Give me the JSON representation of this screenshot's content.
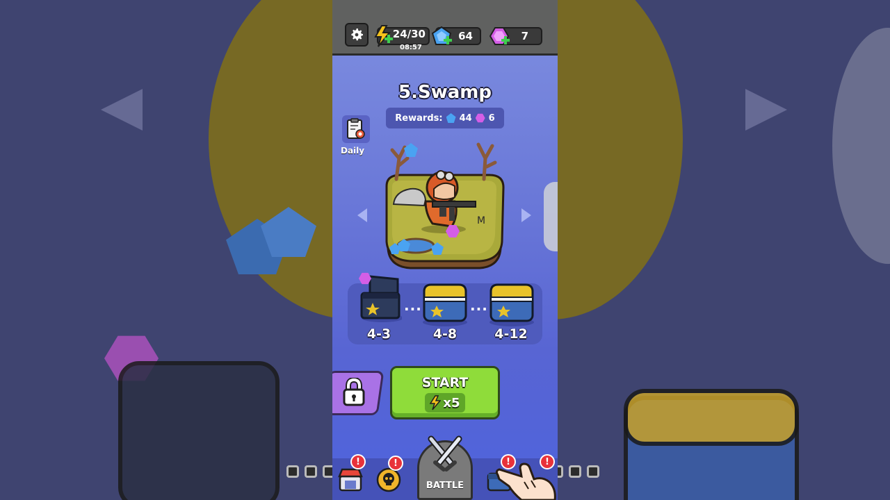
{
  "header": {
    "energy": "24/30",
    "energy_timer": "08:57",
    "blue_gems": "64",
    "purple_gems": "7"
  },
  "level": {
    "title": "5.Swamp",
    "rewards_label": "Rewards:",
    "reward_blue": "44",
    "reward_purple": "6"
  },
  "daily": {
    "label": "Daily"
  },
  "milestones": [
    {
      "label": "4-3",
      "state": "opened"
    },
    {
      "label": "4-8",
      "state": "locked"
    },
    {
      "label": "4-12",
      "state": "locked"
    }
  ],
  "milestone_separator": "...",
  "start": {
    "label": "START",
    "cost": "x5"
  },
  "bottom_nav": {
    "battle_label": "BATTLE",
    "badge_text": "!"
  },
  "colors": {
    "accent_green": "#8fdc3a",
    "accent_purple": "#a972e6",
    "gem_blue": "#4aa3f2",
    "gem_purple": "#d45ee6",
    "energy_yellow": "#f5c21b"
  },
  "icons": [
    "gear-icon",
    "lightning-icon",
    "blue-gem-icon",
    "purple-gem-icon",
    "daily-quest-icon",
    "lock-icon",
    "crossed-swords-icon",
    "shop-icon",
    "skull-coin-icon",
    "chest-icon"
  ]
}
